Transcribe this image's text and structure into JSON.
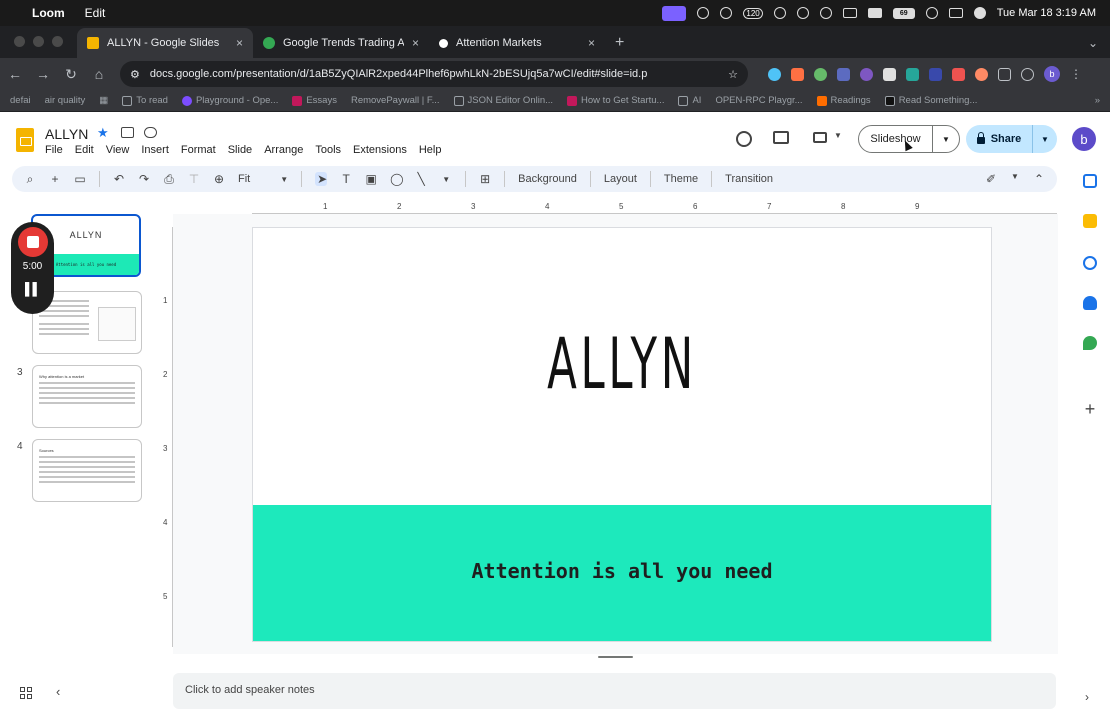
{
  "menubar": {
    "app": "Loom",
    "edit": "Edit",
    "date_time": "Tue Mar 18  3:19 AM"
  },
  "tabs": [
    {
      "title": "ALLYN - Google Slides",
      "active": true,
      "color": "#f4b400"
    },
    {
      "title": "Google Trends Trading Agent",
      "active": false,
      "color": "#34a853"
    },
    {
      "title": "Attention Markets",
      "active": false,
      "color": "#ffffff"
    }
  ],
  "address": {
    "url": "docs.google.com/presentation/d/1aB5ZyQIAlR2xped44Plhef6pwhLkN-2bESUjq5a7wCI/edit#slide=id.p"
  },
  "bookmarks": [
    "defai",
    "air quality",
    "To read",
    "Playground - Ope...",
    "Essays",
    "RemovePaywall | F...",
    "JSON Editor Onlin...",
    "How to Get Startu...",
    "AI",
    "OPEN-RPC Playgr...",
    "Readings",
    "Read Something..."
  ],
  "docs": {
    "title": "ALLYN",
    "menus": [
      "File",
      "Edit",
      "View",
      "Insert",
      "Format",
      "Slide",
      "Arrange",
      "Tools",
      "Extensions",
      "Help"
    ],
    "slideshow_label": "Slideshow",
    "share_label": "Share",
    "account_initial": "b"
  },
  "toolbar": {
    "zoom": "Fit",
    "background": "Background",
    "layout": "Layout",
    "theme": "Theme",
    "transition": "Transition"
  },
  "filmstrip": {
    "slide_numbers": [
      "1",
      "3",
      "4"
    ],
    "thumb1_title": "ALLYN",
    "thumb1_sub": "Attention is all you need",
    "thumb3_heading": "Why attention is a market",
    "thumb4_heading": "Sources"
  },
  "loom": {
    "time": "5:00"
  },
  "ruler": {
    "h": [
      "1",
      "2",
      "3",
      "4",
      "5",
      "6",
      "7",
      "8",
      "9"
    ],
    "v": [
      "1",
      "2",
      "3",
      "4",
      "5"
    ]
  },
  "slide": {
    "title": "ALLYN",
    "subtitle": "Attention is all you need",
    "band_color": "#1de9bc"
  },
  "notes": {
    "placeholder": "Click to add speaker notes"
  }
}
